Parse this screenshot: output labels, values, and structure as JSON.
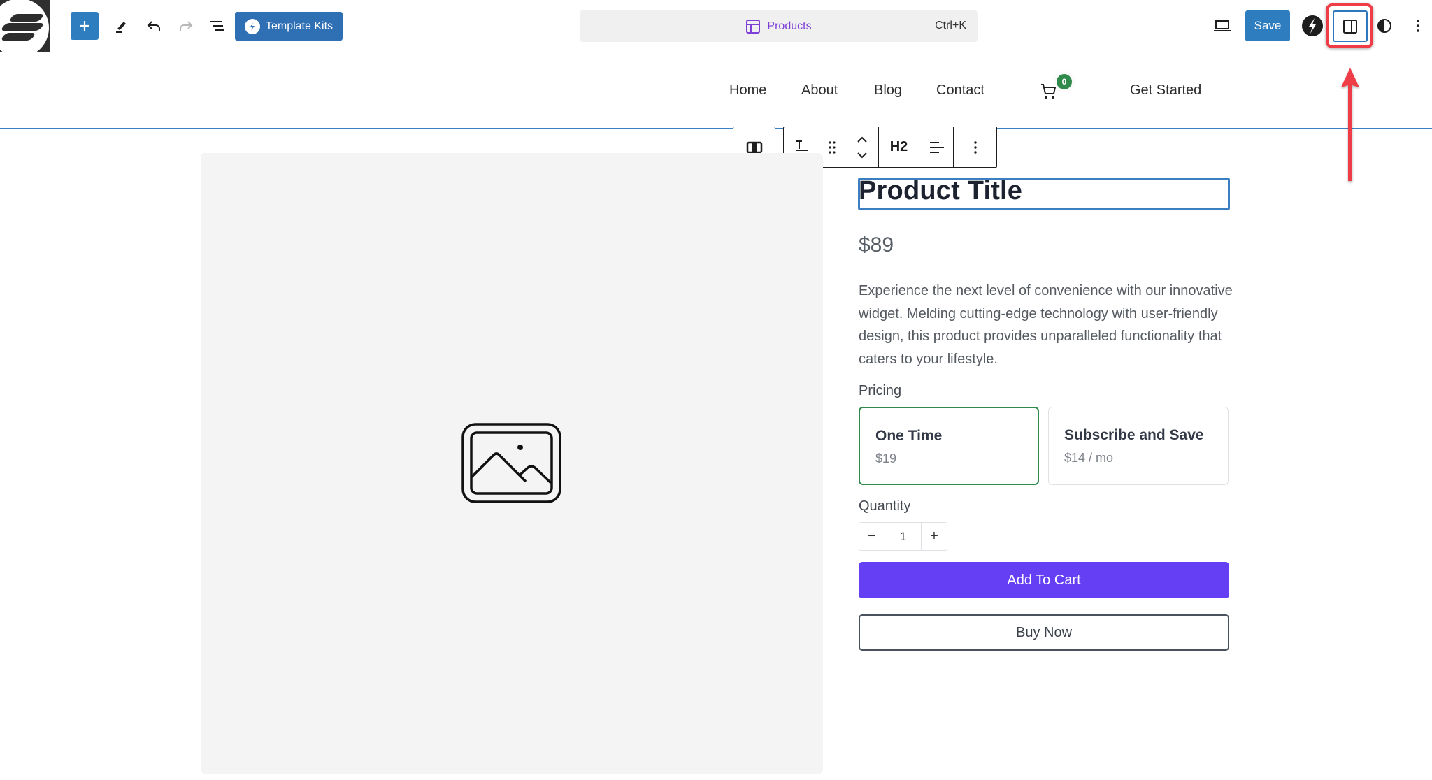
{
  "toolbar": {
    "add_block_label": "+",
    "template_kits_label": "Template Kits",
    "command_bar_label": "Products",
    "command_bar_shortcut": "Ctrl+K",
    "save_label": "Save",
    "icons": [
      "logo-icon",
      "plus-icon",
      "pencil-icon",
      "undo-icon",
      "redo-icon",
      "list-view-icon",
      "template-kits-icon",
      "template-icon",
      "desktop-preview-icon",
      "plugin-bolt-icon",
      "sidebar-toggle-icon",
      "contrast-icon",
      "more-vertical-icon"
    ],
    "accent_color": "#2e7dbf",
    "highlight_color": "#ef3c46"
  },
  "site_header": {
    "nav": [
      "Home",
      "About",
      "Blog",
      "Contact"
    ],
    "cart_count": "0",
    "cta_label": "Get Started"
  },
  "block_toolbar": {
    "heading_level": "H2",
    "icons": [
      "columns-parent-icon",
      "text-style-icon",
      "drag-handle-icon",
      "move-up-down-icon",
      "align-icon",
      "options-icon"
    ]
  },
  "product": {
    "title": "Product Title",
    "price": "$89",
    "description": "Experience the next level of convenience with our innovative widget. Melding cutting-edge technology with user-friendly design, this product provides unparalleled functionality that caters to your lifestyle.",
    "pricing_label": "Pricing",
    "pricing_options": [
      {
        "name": "One Time",
        "price": "$19",
        "selected": true
      },
      {
        "name": "Subscribe and Save",
        "price": "$14 / mo",
        "selected": false
      }
    ],
    "quantity_label": "Quantity",
    "quantity": "1",
    "decrement_label": "−",
    "increment_label": "+",
    "add_to_cart_label": "Add To Cart",
    "buy_now_label": "Buy Now",
    "add_to_cart_color": "#653ff4",
    "selected_option_color": "#2f8a4b"
  }
}
